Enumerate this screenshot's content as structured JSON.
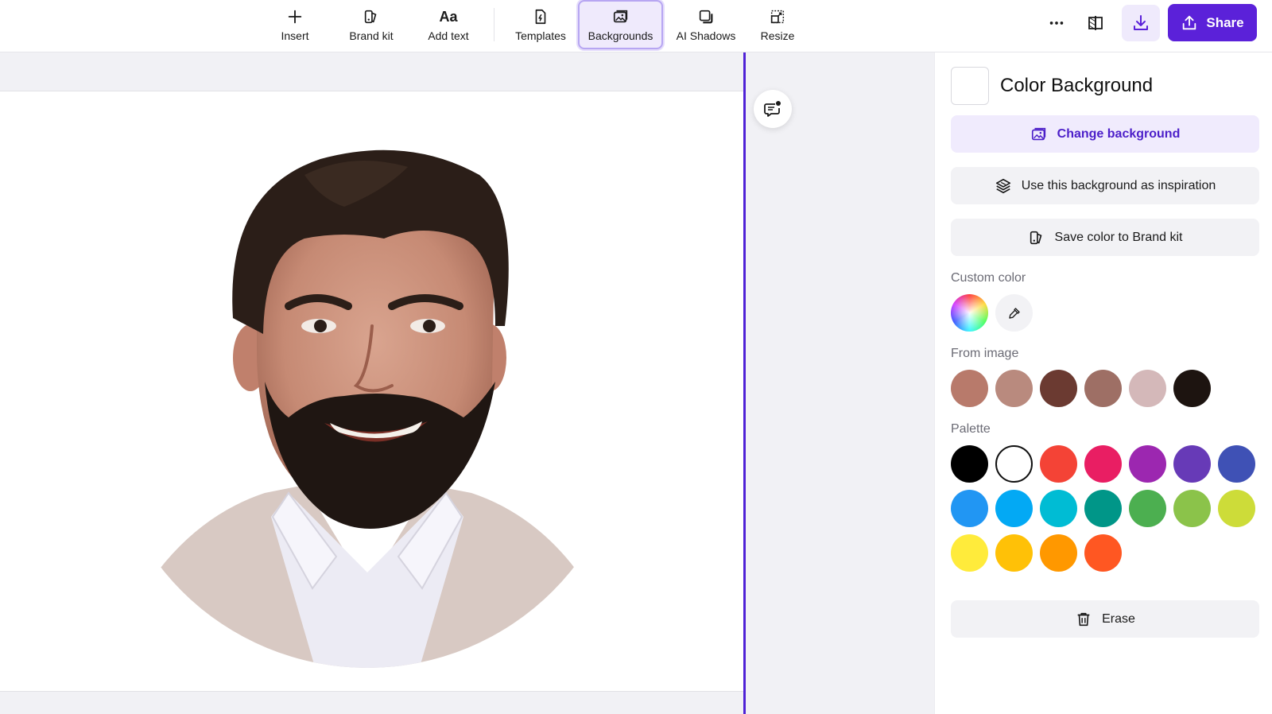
{
  "toolbar": {
    "tools": [
      {
        "label": "Insert",
        "icon": "plus-icon"
      },
      {
        "label": "Brand kit",
        "icon": "brand-kit-icon"
      },
      {
        "label": "Add text",
        "icon": "text-icon"
      },
      {
        "label": "Templates",
        "icon": "templates-icon"
      },
      {
        "label": "Backgrounds",
        "icon": "backgrounds-icon",
        "active": true
      },
      {
        "label": "AI Shadows",
        "icon": "shadows-icon"
      },
      {
        "label": "Resize",
        "icon": "resize-icon"
      }
    ],
    "add_text_glyph": "Aa",
    "share_label": "Share",
    "accent_color": "#5b21d9"
  },
  "panel": {
    "title": "Color Background",
    "change_background_label": "Change background",
    "inspiration_label": "Use this background as inspiration",
    "save_color_label": "Save color to Brand kit",
    "custom_color_label": "Custom color",
    "from_image_label": "From image",
    "palette_label": "Palette",
    "erase_label": "Erase",
    "from_image_colors": [
      "#b87a6b",
      "#b98a7e",
      "#6b3a31",
      "#9e6f65",
      "#d4b8b9",
      "#1d1410"
    ],
    "palette_colors": [
      "#000000",
      "#ffffff",
      "#f44336",
      "#e91e63",
      "#9c27b0",
      "#673ab7",
      "#3f51b5",
      "#2196f3",
      "#03a9f4",
      "#00bcd4",
      "#009688",
      "#4caf50",
      "#8bc34a",
      "#cddc39",
      "#ffeb3b",
      "#ffc107",
      "#ff9800",
      "#ff5722"
    ]
  }
}
